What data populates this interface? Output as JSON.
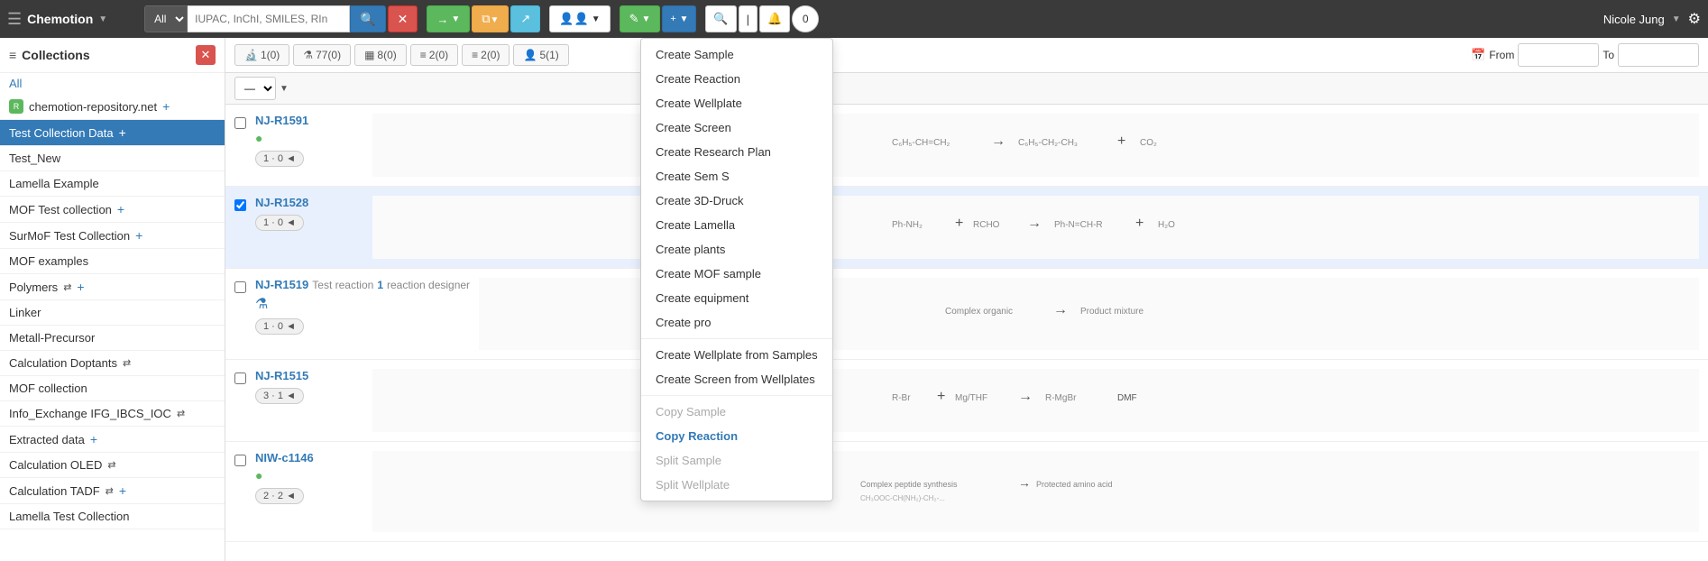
{
  "navbar": {
    "brand": "Chemotion",
    "search_placeholder": "IUPAC, InChI, SMILES, RIn",
    "search_filter": "All",
    "user": "Nicole Jung",
    "create_sample_label": "Create Sample",
    "create_reaction_label": "Create Reaction",
    "create_wellplate_label": "Create Wellplate",
    "create_screen_label": "Create Screen",
    "create_research_plan_label": "Create Research Plan",
    "create_sem_s_label": "Create Sem S",
    "create_3d_druck_label": "Create 3D-Druck",
    "create_lamella_label": "Create Lamella",
    "create_plants_label": "Create plants",
    "create_mof_sample_label": "Create MOF sample",
    "create_equipment_label": "Create equipment",
    "create_pro_label": "Create pro",
    "create_wellplate_from_samples_label": "Create Wellplate from Samples",
    "create_screen_from_wellplates_label": "Create Screen from Wellplates",
    "copy_sample_label": "Copy Sample",
    "copy_reaction_label": "Copy Reaction",
    "split_sample_label": "Split Sample",
    "split_wellplate_label": "Split Wellplate",
    "from_label": "From",
    "to_label": "To"
  },
  "sidebar": {
    "title": "Collections",
    "all_label": "All",
    "repo_item": "chemotion-repository.net",
    "items": [
      {
        "id": "test-collection-data",
        "label": "Test Collection Data",
        "active": true,
        "has_add": true,
        "has_share": false
      },
      {
        "id": "test-new",
        "label": "Test_New",
        "active": false,
        "has_add": false,
        "has_share": false
      },
      {
        "id": "lamella-example",
        "label": "Lamella Example",
        "active": false,
        "has_add": false,
        "has_share": false
      },
      {
        "id": "mof-test-collection",
        "label": "MOF Test collection",
        "active": false,
        "has_add": true,
        "has_share": false
      },
      {
        "id": "surmof-test-collection",
        "label": "SurMoF Test Collection",
        "active": false,
        "has_add": true,
        "has_share": false
      },
      {
        "id": "mof-examples",
        "label": "MOF examples",
        "active": false,
        "has_add": false,
        "has_share": false
      },
      {
        "id": "polymers",
        "label": "Polymers",
        "active": false,
        "has_add": true,
        "has_share": true
      },
      {
        "id": "linker",
        "label": "Linker",
        "active": false,
        "has_add": false,
        "has_share": false
      },
      {
        "id": "metall-precursor",
        "label": "Metall-Precursor",
        "active": false,
        "has_add": false,
        "has_share": false
      },
      {
        "id": "calculation-doptants",
        "label": "Calculation Doptants",
        "active": false,
        "has_add": false,
        "has_share": true
      },
      {
        "id": "mof-collection",
        "label": "MOF collection",
        "active": false,
        "has_add": false,
        "has_share": false
      },
      {
        "id": "info-exchange-ifg-ibcs-ioc",
        "label": "Info_Exchange IFG_IBCS_IOC",
        "active": false,
        "has_add": false,
        "has_share": true
      },
      {
        "id": "extracted-data",
        "label": "Extracted data",
        "active": false,
        "has_add": true,
        "has_share": false
      },
      {
        "id": "calculation-oled",
        "label": "Calculation OLED",
        "active": false,
        "has_add": false,
        "has_share": true
      },
      {
        "id": "calculation-tadf",
        "label": "Calculation TADF",
        "active": false,
        "has_add": true,
        "has_share": true
      },
      {
        "id": "lamella-test-collection",
        "label": "Lamella Test Collection",
        "active": false,
        "has_add": false,
        "has_share": false
      }
    ]
  },
  "tabs": [
    {
      "id": "samples",
      "icon": "🔬",
      "count": "0",
      "label": "1(0)"
    },
    {
      "id": "reactions",
      "icon": "⚗️",
      "count": "77",
      "label": "77(0)"
    },
    {
      "id": "wellplates",
      "icon": "▦",
      "count": "0",
      "label": "8(0)"
    },
    {
      "id": "screens",
      "icon": "≡",
      "count": "0",
      "label": "2(0)"
    },
    {
      "id": "research-plans",
      "icon": "≡",
      "count": "0",
      "label": "2(0)"
    },
    {
      "id": "others",
      "icon": "👤",
      "count": "1",
      "label": "5(1)"
    }
  ],
  "reactions": [
    {
      "id": "NJ-R1591",
      "status": "green",
      "badge1": "1",
      "badge2": "0",
      "badge3": "◄",
      "has_designer": false,
      "tag": null
    },
    {
      "id": "NJ-R1528",
      "status": null,
      "badge1": "1",
      "badge2": "0",
      "badge3": "◄",
      "has_designer": false,
      "tag": null,
      "checked": true
    },
    {
      "id": "NJ-R1519",
      "status": null,
      "badge1": "1",
      "badge2": "0",
      "badge3": "◄",
      "has_designer": true,
      "tag": "Test reaction 1 reaction designer",
      "tag_color": "#337ab7"
    },
    {
      "id": "NJ-R1515",
      "status": null,
      "badge1": "3",
      "badge2": "1",
      "badge3": "◄",
      "has_designer": false,
      "tag": null
    },
    {
      "id": "NIW-c1146",
      "status": "green",
      "badge1": "2",
      "badge2": "2",
      "badge3": "◄",
      "has_designer": false,
      "tag": null
    }
  ],
  "dropdown": {
    "visible": true,
    "items": [
      {
        "id": "create-sample",
        "label": "Create Sample",
        "active": false,
        "disabled": false
      },
      {
        "id": "create-reaction",
        "label": "Create Reaction",
        "active": false,
        "disabled": false
      },
      {
        "id": "create-wellplate",
        "label": "Create Wellplate",
        "active": false,
        "disabled": false
      },
      {
        "id": "create-screen",
        "label": "Create Screen",
        "active": false,
        "disabled": false
      },
      {
        "id": "create-research-plan",
        "label": "Create Research Plan",
        "active": false,
        "disabled": false
      },
      {
        "id": "create-sem-s",
        "label": "Create Sem S",
        "active": false,
        "disabled": false
      },
      {
        "id": "create-3d-druck",
        "label": "Create 3D-Druck",
        "active": false,
        "disabled": false
      },
      {
        "id": "create-lamella",
        "label": "Create Lamella",
        "active": false,
        "disabled": false
      },
      {
        "id": "create-plants",
        "label": "Create plants",
        "active": false,
        "disabled": false
      },
      {
        "id": "create-mof-sample",
        "label": "Create MOF sample",
        "active": false,
        "disabled": false
      },
      {
        "id": "create-equipment",
        "label": "Create equipment",
        "active": false,
        "disabled": false
      },
      {
        "id": "create-pro",
        "label": "Create pro",
        "active": false,
        "disabled": false
      },
      {
        "id": "divider1",
        "type": "divider"
      },
      {
        "id": "create-wellplate-from-samples",
        "label": "Create Wellplate from Samples",
        "active": false,
        "disabled": false
      },
      {
        "id": "create-screen-from-wellplates",
        "label": "Create Screen from Wellplates",
        "active": false,
        "disabled": false
      },
      {
        "id": "divider2",
        "type": "divider"
      },
      {
        "id": "copy-sample",
        "label": "Copy Sample",
        "active": false,
        "disabled": true
      },
      {
        "id": "copy-reaction",
        "label": "Copy Reaction",
        "active": true,
        "disabled": false
      },
      {
        "id": "split-sample",
        "label": "Split Sample",
        "active": false,
        "disabled": true
      },
      {
        "id": "split-wellplate",
        "label": "Split Wellplate",
        "active": false,
        "disabled": true
      }
    ]
  }
}
